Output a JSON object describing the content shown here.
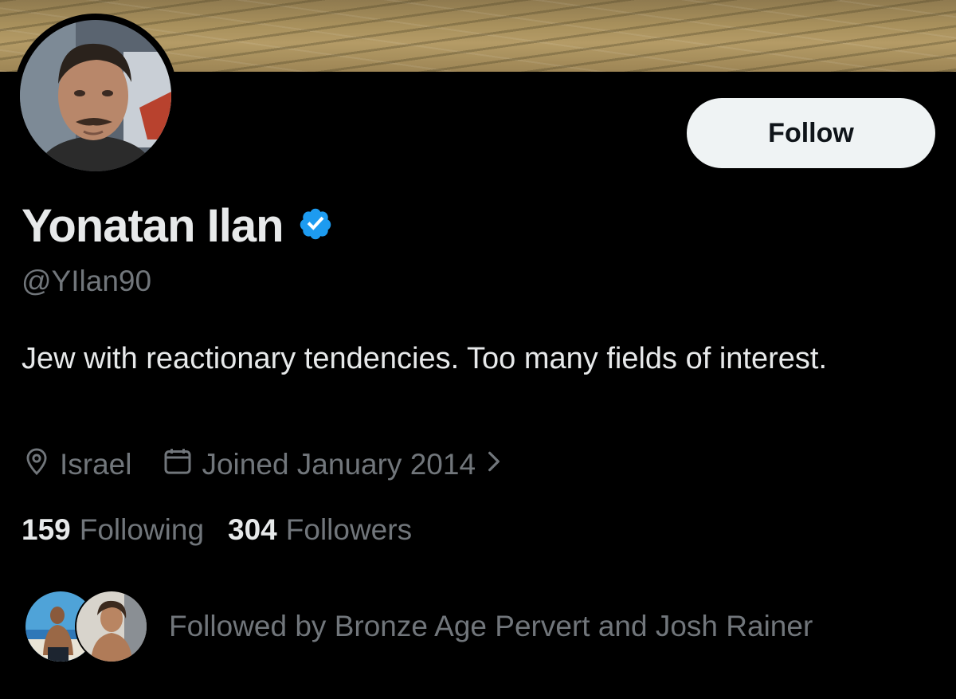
{
  "profile": {
    "display_name": "Yonatan Ilan",
    "handle": "@YIlan90",
    "verified_icon": "verified-badge-icon",
    "bio": "Jew with reactionary tendencies. Too many fields of interest.",
    "location": "Israel",
    "joined": "Joined January 2014"
  },
  "actions": {
    "follow_label": "Follow"
  },
  "stats": {
    "following_count": "159",
    "following_label": "Following",
    "followers_count": "304",
    "followers_label": "Followers"
  },
  "followed_by": {
    "text": "Followed by Bronze Age Pervert and Josh Rainer"
  },
  "icons": {
    "location": "location-pin-icon",
    "calendar": "calendar-icon",
    "chevron": "chevron-right-icon"
  },
  "colors": {
    "background": "#000000",
    "primary_text": "#e7e9ea",
    "secondary_text": "#71767b",
    "verified_blue": "#1d9bf0",
    "follow_button_bg": "#eff3f4"
  }
}
